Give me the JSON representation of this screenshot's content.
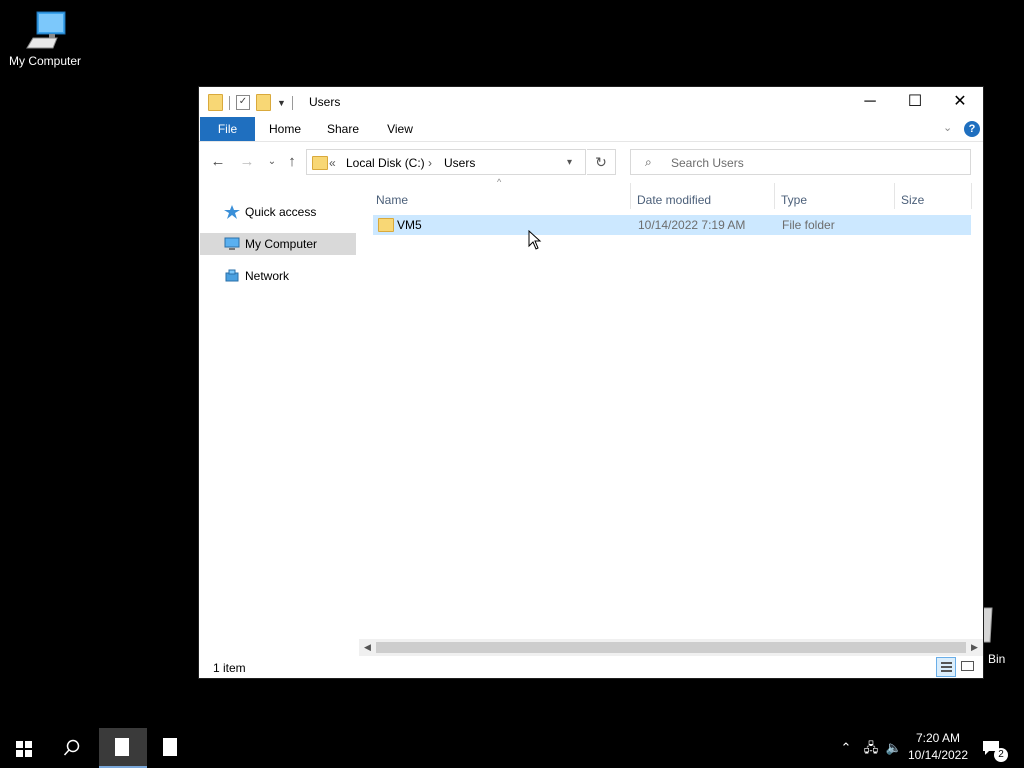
{
  "desktop": {
    "my_computer_label": "My Computer",
    "recycle_bin_label": "Bin"
  },
  "window": {
    "title": "Users",
    "controls": {
      "minimize": "─",
      "maximize": "☐",
      "close": "✕"
    }
  },
  "ribbon": {
    "tabs": [
      "File",
      "Home",
      "Share",
      "View"
    ],
    "help": "?"
  },
  "navigation": {
    "back": "←",
    "forward": "→",
    "recent": "⌄",
    "up": "↑",
    "breadcrumb_prefix": "«",
    "breadcrumb": [
      "Local Disk (C:)",
      "Users"
    ],
    "breadcrumb_separator": "›",
    "refresh": "↻",
    "search_placeholder": "Search Users"
  },
  "nav_pane": {
    "items": [
      {
        "label": "Quick access",
        "icon": "star-icon",
        "selected": false
      },
      {
        "label": "My Computer",
        "icon": "computer-icon",
        "selected": true
      },
      {
        "label": "Network",
        "icon": "network-icon",
        "selected": false
      }
    ]
  },
  "file_list": {
    "columns": [
      "Name",
      "Date modified",
      "Type",
      "Size"
    ],
    "sort_indicator": "^",
    "rows": [
      {
        "name": "VM5",
        "date_modified": "10/14/2022 7:19 AM",
        "type": "File folder",
        "size": "",
        "selected": true
      }
    ]
  },
  "status": {
    "item_count": "1 item"
  },
  "taskbar": {
    "time": "7:20 AM",
    "date": "10/14/2022",
    "notification_count": "2"
  },
  "colors": {
    "accent": "#1f6fbf",
    "selection": "#cce8ff",
    "taskbar": "#000000"
  }
}
